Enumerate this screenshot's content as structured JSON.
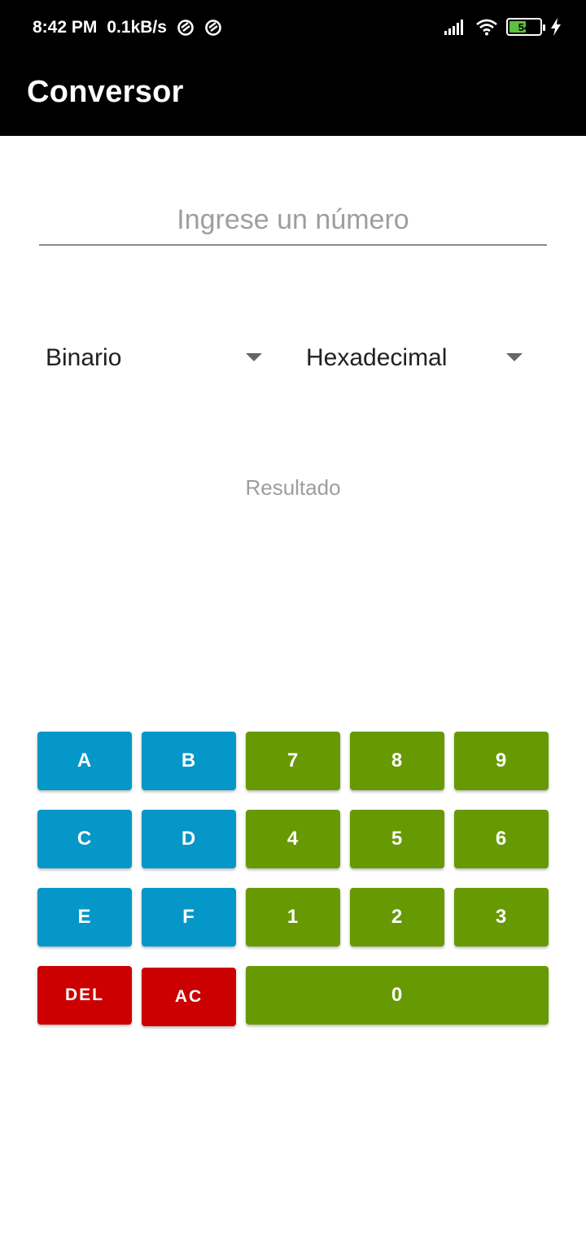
{
  "status_bar": {
    "time": "8:42 PM",
    "speed": "0.1kB/s",
    "battery": "54",
    "icons": [
      "vpn-icon",
      "vpn-icon",
      "signal-icon",
      "wifi-icon",
      "battery-icon",
      "charging-icon"
    ]
  },
  "app_bar": {
    "title": "Conversor"
  },
  "input": {
    "placeholder": "Ingrese un número",
    "value": ""
  },
  "spinners": {
    "from": {
      "selected": "Binario"
    },
    "to": {
      "selected": "Hexadecimal"
    }
  },
  "result": {
    "text": "Resultado"
  },
  "keypad": {
    "a": "A",
    "b": "B",
    "c": "C",
    "d": "D",
    "e": "E",
    "f": "F",
    "n7": "7",
    "n8": "8",
    "n9": "9",
    "n4": "4",
    "n5": "5",
    "n6": "6",
    "n1": "1",
    "n2": "2",
    "n3": "3",
    "n0": "0",
    "del": "DEL",
    "ac": "AC"
  },
  "colors": {
    "hex_keys": "#0497c8",
    "digit_keys": "#679a02",
    "delete_keys": "#cc0000",
    "app_bar": "#000000"
  }
}
